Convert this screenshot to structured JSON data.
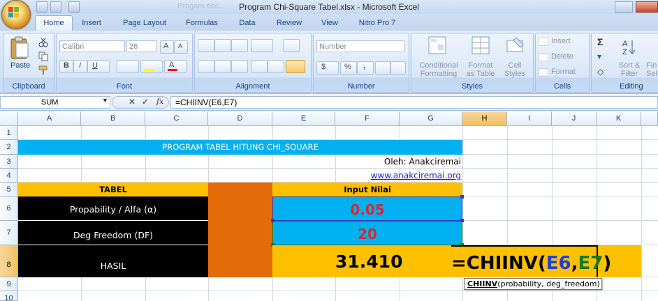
{
  "app": {
    "window_title": "Program Chi-Square Tabel.xlsx - Microsoft Excel",
    "background_window_title": "Progam dbc..."
  },
  "tabs": [
    "Home",
    "Insert",
    "Page Layout",
    "Formulas",
    "Data",
    "Review",
    "View",
    "Nitro Pro 7"
  ],
  "ribbon": {
    "clipboard": {
      "label": "Clipboard",
      "paste": "Paste"
    },
    "font": {
      "label": "Font",
      "font_name": "Calibri",
      "font_size": "26"
    },
    "alignment": {
      "label": "Alignment"
    },
    "number": {
      "label": "Number",
      "format": "Number",
      "currency": "$",
      "percent": "%",
      "comma": ","
    },
    "styles": {
      "label": "Styles",
      "conditional": [
        "Conditional",
        "Formatting"
      ],
      "format_table": [
        "Format",
        "as Table"
      ],
      "cell_styles": [
        "Cell",
        "Styles"
      ]
    },
    "cells": {
      "label": "Cells",
      "insert": "Insert",
      "delete": "Delete",
      "format": "Format"
    },
    "editing": {
      "label": "Editing",
      "sort": [
        "Sort &",
        "Filter"
      ],
      "find": [
        "Fin",
        "Sel"
      ]
    }
  },
  "formula_bar": {
    "name_box": "SUM",
    "fx": "fx",
    "formula": "=CHIINV(E6,E7)"
  },
  "columns": [
    "A",
    "B",
    "C",
    "D",
    "E",
    "F",
    "G",
    "H",
    "I",
    "J",
    "K"
  ],
  "rows": [
    "1",
    "2",
    "3",
    "4",
    "5",
    "6",
    "7",
    "8",
    "9",
    "10"
  ],
  "sheet": {
    "banner": "PROGRAM TABEL HITUNG CHI_SQUARE",
    "author": "Oleh: Anakciremai",
    "website": "www.anakciremai.org",
    "table_header": "TABEL",
    "input_header": "Input Nilai",
    "row_alpha_label": "Propability / Alfa (α)",
    "row_alpha_value": "0.05",
    "row_df_label": "Deg Freedom (DF)",
    "row_df_value": "20",
    "result_label": "HASIL",
    "result_value": "31.410",
    "edit_formula": {
      "prefix": "=CHIINV(",
      "ref1": "E6",
      "sep": ",",
      "ref2": "E7",
      "suffix": ")"
    },
    "tooltip": {
      "fn": "CHIINV",
      "args": "(probability, deg_freedom)"
    }
  },
  "colors": {
    "banner_bg": "#00b0f0",
    "header_bg": "#ffc000",
    "label_bg": "#000000",
    "d_col_bg": "#e36c09",
    "input_bg": "#00b0f0",
    "value_red": "#e0242e",
    "ref_blue": "#1f3fd8",
    "ref_green": "#1a7a1a"
  }
}
